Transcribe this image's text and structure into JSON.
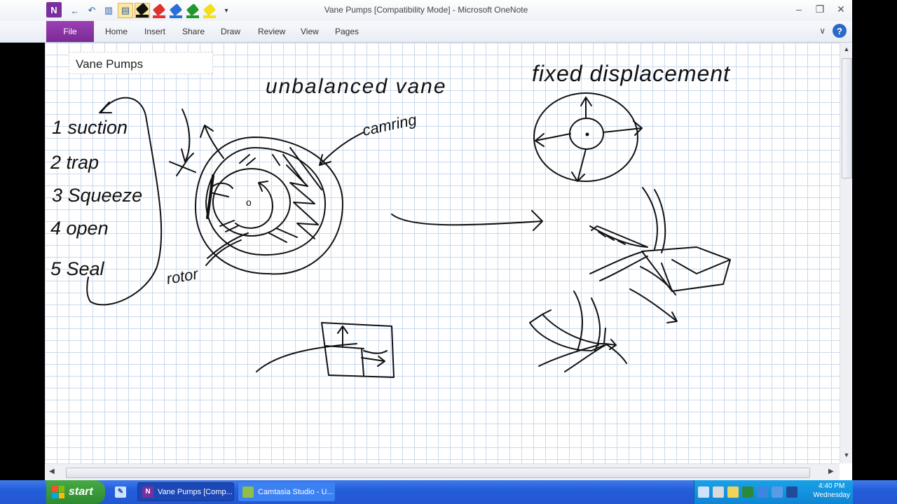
{
  "window": {
    "title": "Vane Pumps [Compatibility Mode] - Microsoft OneNote",
    "logo_letter": "N"
  },
  "ribbon": {
    "file_label": "File",
    "tabs": [
      "Home",
      "Insert",
      "Share",
      "Draw",
      "Review",
      "View",
      "Pages"
    ]
  },
  "page": {
    "title": "Vane Pumps"
  },
  "ink_text": {
    "heading_left": "unbalanced vane",
    "heading_right": "fixed displacement",
    "cam_ring": "camring",
    "rotor": "rotor",
    "steps": [
      "1 suction",
      "2 trap",
      "3 Squeeze",
      "4 open",
      "5 Seal"
    ],
    "center_mark": "o"
  },
  "pen_colors": [
    "#111111",
    "#e03030",
    "#2a6fd6",
    "#1d9a2a",
    "#f2e01a"
  ],
  "taskbar": {
    "start_label": "start",
    "items": [
      {
        "label": "Vane Pumps [Comp...",
        "icon_letter": "N"
      },
      {
        "label": "Camtasia Studio - U...",
        "icon_letter": ""
      }
    ],
    "clock_time": "4:40 PM",
    "clock_day": "Wednesday"
  }
}
